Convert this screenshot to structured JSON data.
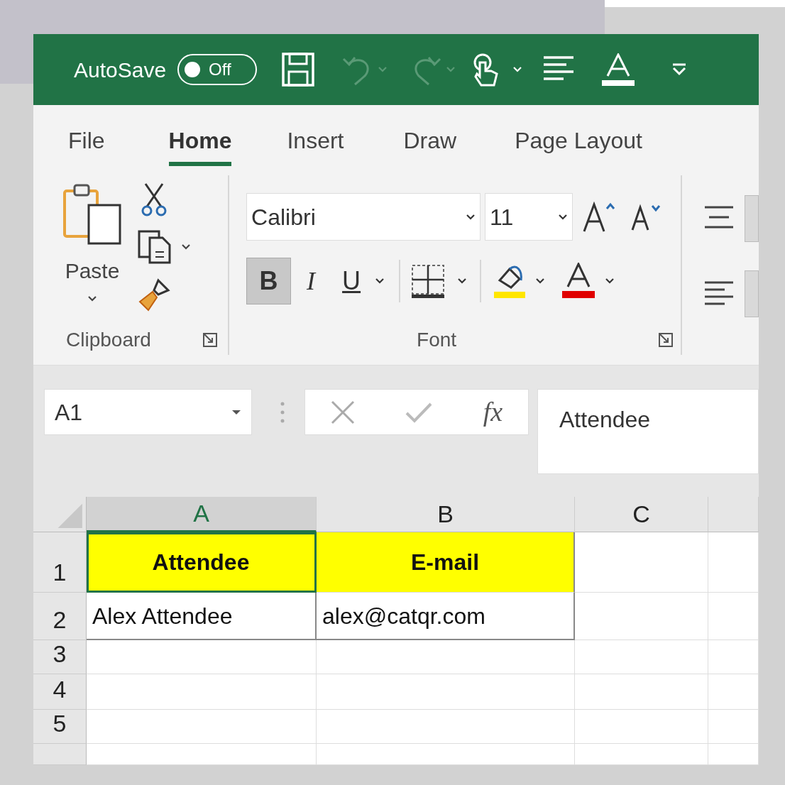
{
  "title_bar": {
    "autosave_label": "AutoSave",
    "autosave_toggle": {
      "on": false,
      "label": "Off"
    }
  },
  "tabs": [
    {
      "label": "File",
      "selected": false
    },
    {
      "label": "Home",
      "selected": true
    },
    {
      "label": "Insert",
      "selected": false
    },
    {
      "label": "Draw",
      "selected": false
    },
    {
      "label": "Page Layout",
      "selected": false
    }
  ],
  "ribbon": {
    "clipboard": {
      "paste_label": "Paste",
      "group_label": "Clipboard"
    },
    "font": {
      "font_name": "Calibri",
      "font_size": "11",
      "bold_label": "B",
      "bold_on": true,
      "italic_label": "I",
      "underline_label": "U",
      "group_label": "Font"
    }
  },
  "formula_bar": {
    "name_box": "A1",
    "function_label": "fx",
    "formula": "Attendee"
  },
  "sheet": {
    "columns": [
      {
        "label": "A",
        "selected": true
      },
      {
        "label": "B",
        "selected": false
      },
      {
        "label": "C",
        "selected": false
      }
    ],
    "rows": [
      {
        "number": "1",
        "cells": [
          {
            "text": "Attendee",
            "bold": true,
            "color": "#ffff00",
            "selected": true
          },
          {
            "text": "E-mail",
            "bold": true,
            "color": "#ffff00",
            "selected": false
          }
        ]
      },
      {
        "number": "2",
        "cells": [
          {
            "text": "Alex Attendee",
            "bold": false,
            "selected": false
          },
          {
            "text": "alex@catqr.com",
            "bold": false,
            "selected": false
          }
        ]
      },
      {
        "number": "3"
      },
      {
        "number": "4"
      },
      {
        "number": "5"
      }
    ]
  }
}
